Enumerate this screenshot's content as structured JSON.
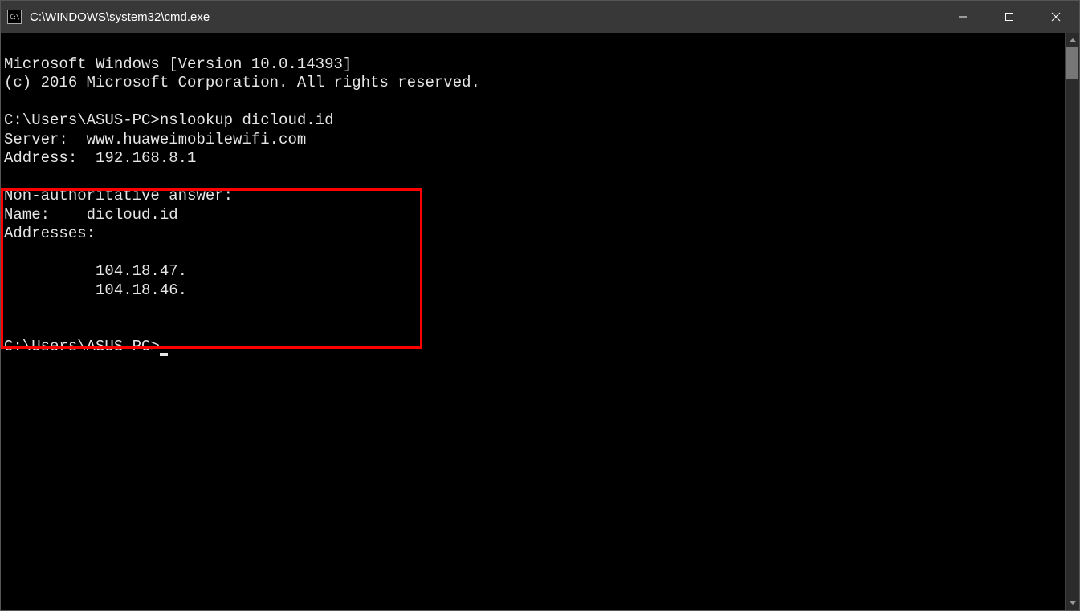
{
  "window": {
    "icon_label": "C:\\",
    "title": "C:\\WINDOWS\\system32\\cmd.exe"
  },
  "terminal": {
    "lines": {
      "l1": "Microsoft Windows [Version 10.0.14393]",
      "l2": "(c) 2016 Microsoft Corporation. All rights reserved.",
      "l3": "",
      "l4": "C:\\Users\\ASUS-PC>nslookup dicloud.id",
      "l5": "Server:  www.huaweimobilewifi.com",
      "l6": "Address:  192.168.8.1",
      "l7": "",
      "l8": "Non-authoritative answer:",
      "l9": "Name:    dicloud.id",
      "l10": "Addresses:",
      "l11": "",
      "l12": "          104.18.47.",
      "l13": "          104.18.46.",
      "l14": "",
      "l15": "",
      "l16": "C:\\Users\\ASUS-PC>"
    }
  }
}
